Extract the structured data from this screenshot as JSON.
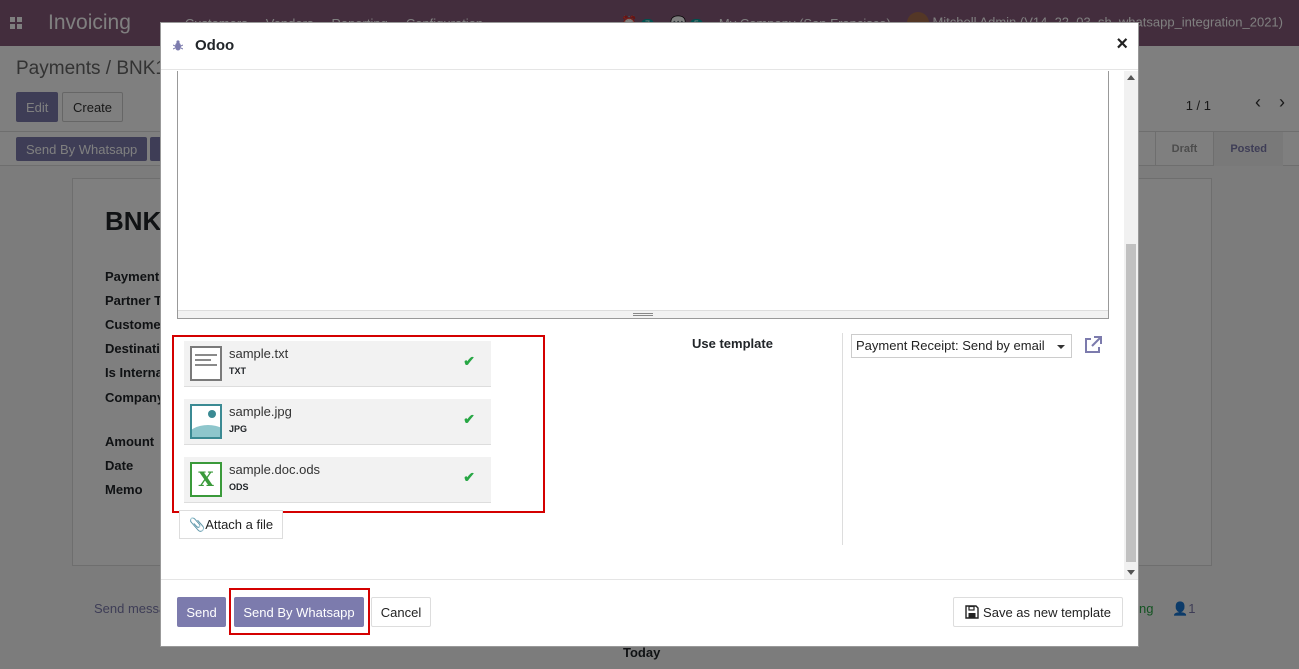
{
  "app": {
    "brand": "Invoicing",
    "menu": [
      "Customers",
      "Vendors",
      "Reporting",
      "Configuration"
    ],
    "activity_count": "7",
    "message_count": "5",
    "company": "My Company (San Francisco)",
    "user": "Mitchell Admin (V14_22_03_sh_whatsapp_integration_2021)"
  },
  "control_panel": {
    "breadcrumb": "Payments / BNK1/",
    "edit_label": "Edit",
    "create_label": "Create",
    "pager": "1 / 1",
    "send_whatsapp_label": "Send By Whatsapp"
  },
  "status": {
    "steps": [
      "Draft",
      "Posted"
    ],
    "active": "Posted"
  },
  "form": {
    "title": "BNK",
    "labels": [
      "Payment",
      "Partner T",
      "Custome",
      "Destinati",
      "Is Interna",
      "Company",
      "Amount",
      "Date",
      "Memo"
    ]
  },
  "chatter": {
    "send_message": "Send messa",
    "log_suffix": "ng",
    "followers": "1",
    "today": "Today"
  },
  "modal": {
    "title": "Odoo",
    "close_label": "×",
    "attachments": [
      {
        "name": "sample.txt",
        "ext": "TXT",
        "icon": "text-file-icon"
      },
      {
        "name": "sample.jpg",
        "ext": "JPG",
        "icon": "image-file-icon"
      },
      {
        "name": "sample.doc.ods",
        "ext": "ODS",
        "icon": "spreadsheet-file-icon"
      }
    ],
    "attach_label": "Attach a file",
    "use_template_label": "Use template",
    "template_value": "Payment Receipt: Send by email",
    "footer": {
      "send_label": "Send",
      "whatsapp_label": "Send By Whatsapp",
      "cancel_label": "Cancel",
      "save_template_label": "Save as new template"
    }
  },
  "colors": {
    "brand": "#875a7b",
    "primary": "#7c7bad",
    "highlight": "#d40000",
    "success": "#28a745"
  }
}
